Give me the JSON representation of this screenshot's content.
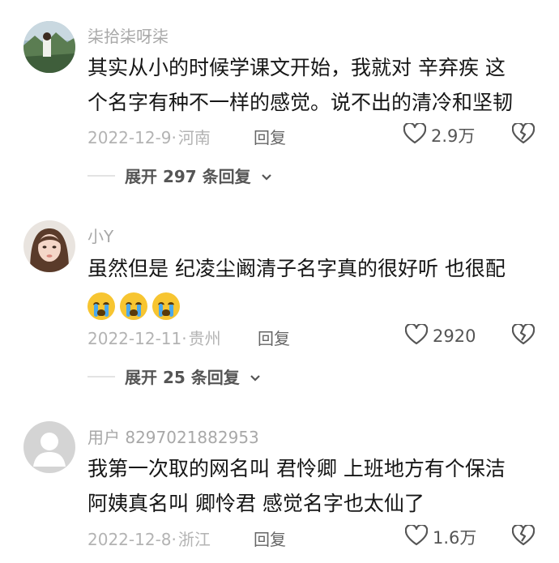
{
  "comments": [
    {
      "username": "柒拾柒呀柒",
      "lines": [
        "其实从小的时候学课文开始，我就对 辛弃疾 这",
        "个名字有种不一样的感觉。说不出的清冷和坚韧"
      ],
      "date": "2022-12-9",
      "location": "河南",
      "reply_label": "回复",
      "likes": "2.9万",
      "expand_label": "展开 297 条回复"
    },
    {
      "username": "小Y",
      "lines": [
        "虽然但是 纪凌尘阚清子名字真的很好听 也很配"
      ],
      "emojis": [
        "loudly-crying-emoji",
        "loudly-crying-emoji",
        "loudly-crying-emoji"
      ],
      "date": "2022-12-11",
      "location": "贵州",
      "reply_label": "回复",
      "likes": "2920",
      "expand_label": "展开 25 条回复"
    },
    {
      "username": "用户 8297021882953",
      "lines": [
        "我第一次取的网名叫 君怜卿   上班地方有个保洁",
        "阿姨真名叫 卿怜君  感觉名字也太仙了"
      ],
      "date": "2022-12-8",
      "location": "浙江",
      "reply_label": "回复",
      "likes": "1.6万"
    }
  ],
  "meta_separator": "·",
  "icons": {
    "like": "heart-outline-icon",
    "dislike": "broken-heart-icon",
    "expand": "chevron-down-icon"
  },
  "colors": {
    "username": "#a8a8a8",
    "meta": "#b3b3b3",
    "text": "#161616"
  }
}
